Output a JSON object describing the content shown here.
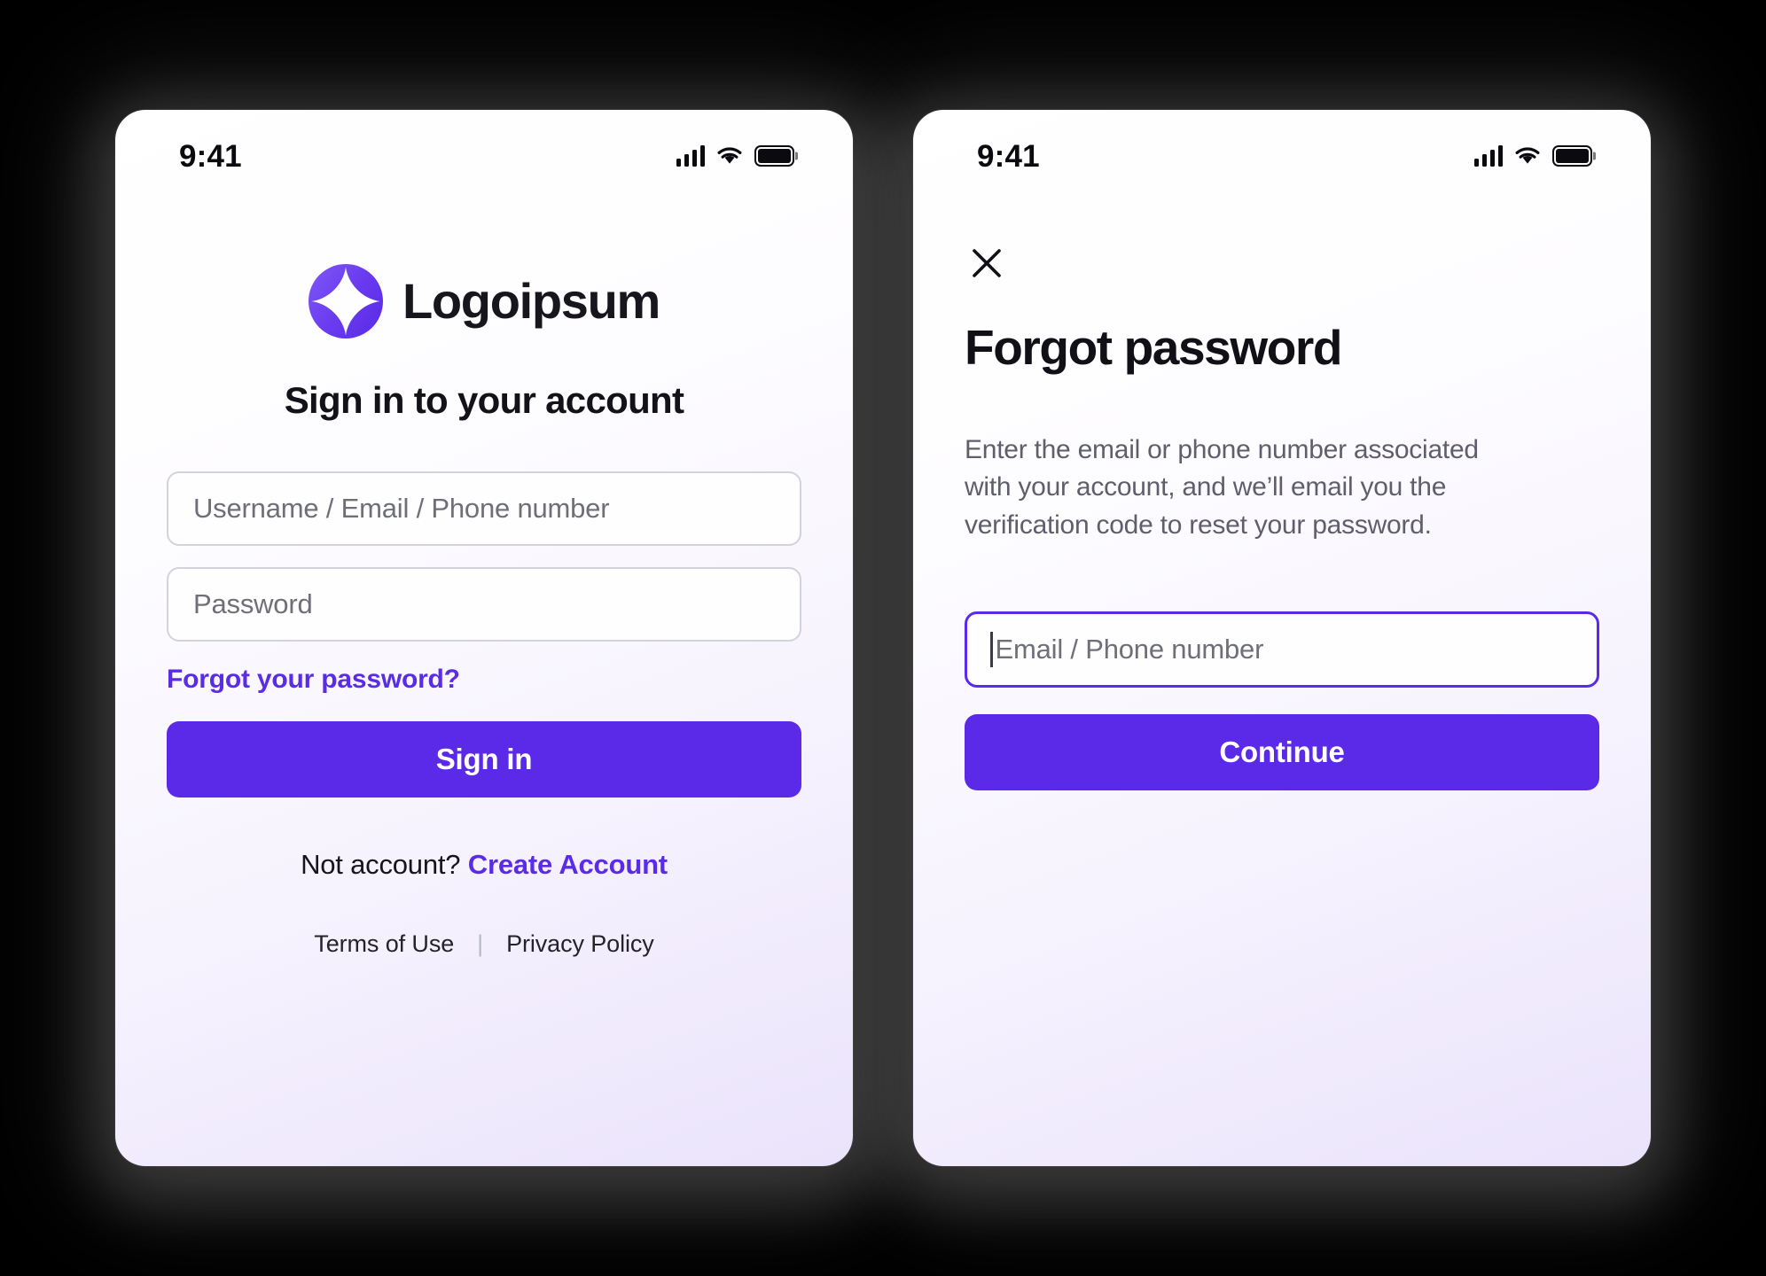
{
  "theme": {
    "accent": "#5B2AE8",
    "link": "#5A2CE6",
    "text_primary": "#101016",
    "text_muted": "#5F5F6B",
    "placeholder": "#6F6F7A",
    "field_border": "#D3D3DC",
    "backdrop": "#000000",
    "card_gradient_from": "#FFFFFF",
    "card_gradient_to": "#EAE3FB"
  },
  "signin_screen": {
    "status_bar": {
      "time": "9:41",
      "icons": [
        "cellular-signal-icon",
        "wifi-icon",
        "battery-icon"
      ]
    },
    "brand": {
      "logo_icon": "four-point-star-logo-icon",
      "name": "Logoipsum"
    },
    "title": "Sign in to your account",
    "username_field": {
      "placeholder": "Username / Email / Phone number",
      "value": ""
    },
    "password_field": {
      "placeholder": "Password",
      "value": ""
    },
    "forgot_link": "Forgot your password?",
    "submit_button": "Sign in",
    "create_account": {
      "prompt": "Not account?",
      "link": "Create Account"
    },
    "legal": {
      "terms": "Terms of Use",
      "separator": "|",
      "privacy": "Privacy Policy"
    }
  },
  "forgot_screen": {
    "status_bar": {
      "time": "9:41",
      "icons": [
        "cellular-signal-icon",
        "wifi-icon",
        "battery-icon"
      ]
    },
    "close_icon": "close-x-icon",
    "title": "Forgot password",
    "description": "Enter the email or phone number associated with your account, and we’ll email you the verification code to reset your password.",
    "email_field": {
      "placeholder": "Email / Phone number",
      "value": "",
      "focused": true
    },
    "submit_button": "Continue"
  }
}
